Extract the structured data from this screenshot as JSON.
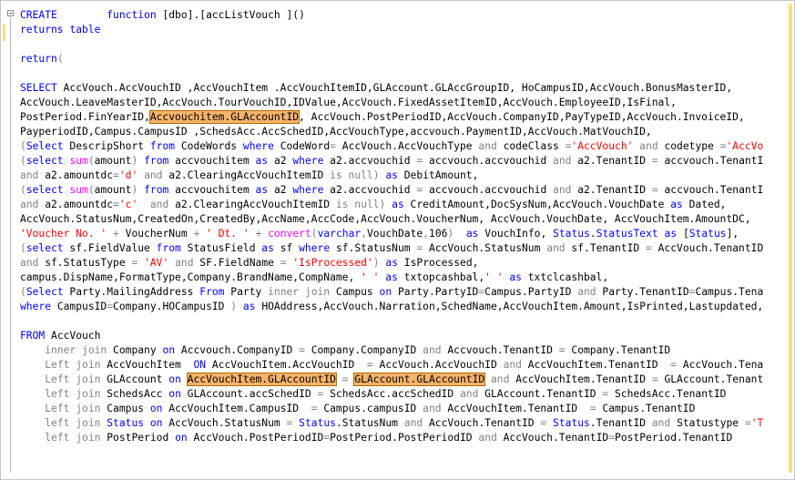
{
  "editor": {
    "lines": [
      [
        [
          "k",
          "CREATE"
        ],
        [
          "t",
          "        "
        ],
        [
          "k",
          "function"
        ],
        [
          "t",
          " [dbo].[accListVouch ]()"
        ]
      ],
      [
        [
          "k",
          "returns"
        ],
        [
          "t",
          " "
        ],
        [
          "k",
          "table"
        ]
      ],
      [],
      [
        [
          "k",
          "return"
        ],
        [
          "p",
          "("
        ]
      ],
      [],
      [
        [
          "k",
          "SELECT"
        ],
        [
          "t",
          " AccVouch.AccVouchID ,AccVouchItem .AccVouchItemID,GLAccount.GLAccGroupID, HoCampusID,AccVouch.BonusMasterID,"
        ]
      ],
      [
        [
          "t",
          "AccVouch.LeaveMasterID,AccVouch.TourVouchID,IDValue,AccVouch.FixedAssetItemID,AccVouch.EmployeeID,IsFinal,"
        ]
      ],
      [
        [
          "t",
          "PostPeriod.FinYearID,"
        ],
        [
          "h",
          "Accvouchitem.GLAccountID"
        ],
        [
          "t",
          ", AccVouch.PostPeriodID,AccVouch.CompanyID,PayTypeID,AccVouch.InvoiceID,"
        ]
      ],
      [
        [
          "t",
          "PayperiodID,Campus.CampusID ,SchedsAcc.AccSchedID,AccVouchType,accvouch.PaymentID,AccVouch.MatVouchID,"
        ]
      ],
      [
        [
          "p",
          "("
        ],
        [
          "k",
          "Select"
        ],
        [
          "t",
          " DescripShort "
        ],
        [
          "k",
          "from"
        ],
        [
          "t",
          " CodeWords "
        ],
        [
          "k",
          "where"
        ],
        [
          "t",
          " CodeWord"
        ],
        [
          "p",
          "="
        ],
        [
          "t",
          " AccVouch.AccVouchType "
        ],
        [
          "p",
          "and"
        ],
        [
          "t",
          " codeClass "
        ],
        [
          "p",
          "="
        ],
        [
          "s",
          "'AccVouch'"
        ],
        [
          "t",
          " "
        ],
        [
          "p",
          "and"
        ],
        [
          "t",
          " codetype "
        ],
        [
          "p",
          "="
        ],
        [
          "s",
          "'AccVo"
        ]
      ],
      [
        [
          "p",
          "("
        ],
        [
          "k",
          "select"
        ],
        [
          "t",
          " "
        ],
        [
          "f",
          "sum"
        ],
        [
          "p",
          "("
        ],
        [
          "t",
          "amount"
        ],
        [
          "p",
          ")"
        ],
        [
          "t",
          " "
        ],
        [
          "k",
          "from"
        ],
        [
          "t",
          " accvouchitem "
        ],
        [
          "k",
          "as"
        ],
        [
          "t",
          " a2 "
        ],
        [
          "k",
          "where"
        ],
        [
          "t",
          " a2.accvouchid "
        ],
        [
          "p",
          "="
        ],
        [
          "t",
          " accvouch.accvouchid "
        ],
        [
          "p",
          "and"
        ],
        [
          "t",
          " a2.TenantID "
        ],
        [
          "p",
          "="
        ],
        [
          "t",
          " accvouch.TenantI"
        ]
      ],
      [
        [
          "p",
          "and"
        ],
        [
          "t",
          " a2.amountdc"
        ],
        [
          "p",
          "="
        ],
        [
          "s",
          "'d'"
        ],
        [
          "t",
          " "
        ],
        [
          "p",
          "and"
        ],
        [
          "t",
          " a2.ClearingAccVouchItemID "
        ],
        [
          "p",
          "is null)"
        ],
        [
          "t",
          " "
        ],
        [
          "k",
          "as"
        ],
        [
          "t",
          " DebitAmount,"
        ]
      ],
      [
        [
          "p",
          "("
        ],
        [
          "k",
          "select"
        ],
        [
          "t",
          " "
        ],
        [
          "f",
          "sum"
        ],
        [
          "p",
          "("
        ],
        [
          "t",
          "amount"
        ],
        [
          "p",
          ")"
        ],
        [
          "t",
          " "
        ],
        [
          "k",
          "from"
        ],
        [
          "t",
          " accvouchitem "
        ],
        [
          "k",
          "as"
        ],
        [
          "t",
          " a2 "
        ],
        [
          "k",
          "where"
        ],
        [
          "t",
          " a2.accvouchid "
        ],
        [
          "p",
          "="
        ],
        [
          "t",
          " accvouch.accvouchid "
        ],
        [
          "p",
          "and"
        ],
        [
          "t",
          " a2.TenantID "
        ],
        [
          "p",
          "="
        ],
        [
          "t",
          " accvouch.TenantI"
        ]
      ],
      [
        [
          "p",
          "and"
        ],
        [
          "t",
          " a2.amountdc"
        ],
        [
          "p",
          "="
        ],
        [
          "s",
          "'c'"
        ],
        [
          "t",
          "  "
        ],
        [
          "p",
          "and"
        ],
        [
          "t",
          " a2.ClearingAccVouchItemID "
        ],
        [
          "p",
          "is null)"
        ],
        [
          "t",
          " "
        ],
        [
          "k",
          "as"
        ],
        [
          "t",
          " CreditAmount,DocSysNum,AccVouch.VouchDate "
        ],
        [
          "k",
          "as"
        ],
        [
          "t",
          " Dated,"
        ]
      ],
      [
        [
          "t",
          "AccVouch.StatusNum,CreatedOn,CreatedBy,AccName,AccCode,AccVouch.VoucherNum, AccVouch.VouchDate, AccVouchItem.AmountDC,"
        ]
      ],
      [
        [
          "s",
          "'Voucher No. '"
        ],
        [
          "t",
          " "
        ],
        [
          "p",
          "+"
        ],
        [
          "t",
          " VoucherNum "
        ],
        [
          "p",
          "+"
        ],
        [
          "t",
          " "
        ],
        [
          "s",
          "' Dt. '"
        ],
        [
          "t",
          " "
        ],
        [
          "p",
          "+"
        ],
        [
          "t",
          " "
        ],
        [
          "f",
          "convert"
        ],
        [
          "p",
          "("
        ],
        [
          "k",
          "varchar"
        ],
        [
          "p",
          ","
        ],
        [
          "t",
          "VouchDate"
        ],
        [
          "p",
          ","
        ],
        [
          "t",
          "106"
        ],
        [
          "p",
          ")"
        ],
        [
          "t",
          "  "
        ],
        [
          "k",
          "as"
        ],
        [
          "t",
          " VouchInfo, "
        ],
        [
          "k",
          "Status"
        ],
        [
          "t",
          "."
        ],
        [
          "k",
          "StatusText"
        ],
        [
          "t",
          " "
        ],
        [
          "k",
          "as"
        ],
        [
          "t",
          " ["
        ],
        [
          "k",
          "Status"
        ],
        [
          "t",
          "],"
        ]
      ],
      [
        [
          "p",
          "("
        ],
        [
          "k",
          "select"
        ],
        [
          "t",
          " sf.FieldValue "
        ],
        [
          "k",
          "from"
        ],
        [
          "t",
          " StatusField "
        ],
        [
          "k",
          "as"
        ],
        [
          "t",
          " sf "
        ],
        [
          "k",
          "where"
        ],
        [
          "t",
          " sf.StatusNum "
        ],
        [
          "p",
          "="
        ],
        [
          "t",
          " AccVouch.StatusNum "
        ],
        [
          "p",
          "and"
        ],
        [
          "t",
          " sf.TenantID "
        ],
        [
          "p",
          "="
        ],
        [
          "t",
          " AccVouch.TenantID"
        ]
      ],
      [
        [
          "p",
          "and"
        ],
        [
          "t",
          " sf.StatusType "
        ],
        [
          "p",
          "="
        ],
        [
          "t",
          " "
        ],
        [
          "s",
          "'AV'"
        ],
        [
          "t",
          " "
        ],
        [
          "p",
          "and"
        ],
        [
          "t",
          " SF.FieldName "
        ],
        [
          "p",
          "="
        ],
        [
          "t",
          " "
        ],
        [
          "s",
          "'IsProcessed'"
        ],
        [
          "p",
          ")"
        ],
        [
          "t",
          " "
        ],
        [
          "k",
          "as"
        ],
        [
          "t",
          " IsProcessed,"
        ]
      ],
      [
        [
          "t",
          "campus.DispName,FormatType,Company.BrandName,CompName, "
        ],
        [
          "s",
          "' '"
        ],
        [
          "t",
          " "
        ],
        [
          "k",
          "as"
        ],
        [
          "t",
          " txtopcashbal,"
        ],
        [
          "s",
          "' '"
        ],
        [
          "t",
          " "
        ],
        [
          "k",
          "as"
        ],
        [
          "t",
          " txtclcashbal,"
        ]
      ],
      [
        [
          "p",
          "("
        ],
        [
          "k",
          "Select"
        ],
        [
          "t",
          " Party.MailingAddress "
        ],
        [
          "k",
          "From"
        ],
        [
          "t",
          " Party "
        ],
        [
          "p",
          "inner join"
        ],
        [
          "t",
          " Campus "
        ],
        [
          "k",
          "on"
        ],
        [
          "t",
          " Party.PartyID"
        ],
        [
          "p",
          "="
        ],
        [
          "t",
          "Campus.PartyID "
        ],
        [
          "p",
          "and"
        ],
        [
          "t",
          " Party.TenantID"
        ],
        [
          "p",
          "="
        ],
        [
          "t",
          "Campus.Tena"
        ]
      ],
      [
        [
          "k",
          "where"
        ],
        [
          "t",
          " CampusID"
        ],
        [
          "p",
          "="
        ],
        [
          "t",
          "Company.HOCampusID "
        ],
        [
          "p",
          ")"
        ],
        [
          "t",
          " "
        ],
        [
          "k",
          "as"
        ],
        [
          "t",
          " HOAddress,AccVouch.Narration,SchedName,AccVouchItem.Amount,IsPrinted,Lastupdated,"
        ]
      ],
      [],
      [
        [
          "k",
          "FROM"
        ],
        [
          "t",
          " AccVouch"
        ]
      ],
      [
        [
          "t",
          "    "
        ],
        [
          "p",
          "inner join"
        ],
        [
          "t",
          " Company "
        ],
        [
          "k",
          "on"
        ],
        [
          "t",
          " Accvouch.CompanyID "
        ],
        [
          "p",
          "="
        ],
        [
          "t",
          " Company.CompanyID "
        ],
        [
          "p",
          "and"
        ],
        [
          "t",
          " Accvouch.TenantID "
        ],
        [
          "p",
          "="
        ],
        [
          "t",
          " Company.TenantID"
        ]
      ],
      [
        [
          "t",
          "    "
        ],
        [
          "p",
          "Left join"
        ],
        [
          "t",
          " AccVouchItem  "
        ],
        [
          "k",
          "ON"
        ],
        [
          "t",
          " AccVouchItem.AccVouchID  "
        ],
        [
          "p",
          "="
        ],
        [
          "t",
          " AccVouch.AccVouchID "
        ],
        [
          "p",
          "and"
        ],
        [
          "t",
          " AccVouchItem.TenantID  "
        ],
        [
          "p",
          "="
        ],
        [
          "t",
          " AccVouch.Tena"
        ]
      ],
      [
        [
          "t",
          "    "
        ],
        [
          "p",
          "Left join"
        ],
        [
          "t",
          " GLAccount "
        ],
        [
          "k",
          "on"
        ],
        [
          "t",
          " "
        ],
        [
          "h",
          "AccVouchItem.GLAccountID"
        ],
        [
          "t",
          " "
        ],
        [
          "p",
          "="
        ],
        [
          "t",
          " "
        ],
        [
          "h",
          "GLAccount.GLAccountID"
        ],
        [
          "t",
          " "
        ],
        [
          "p",
          "and"
        ],
        [
          "t",
          " AccVouchItem.TenantID "
        ],
        [
          "p",
          "="
        ],
        [
          "t",
          " GLAccount.Tenant"
        ]
      ],
      [
        [
          "t",
          "    "
        ],
        [
          "p",
          "left join"
        ],
        [
          "t",
          " SchedsAcc "
        ],
        [
          "k",
          "on"
        ],
        [
          "t",
          " GLAccount.accSchedID "
        ],
        [
          "p",
          "="
        ],
        [
          "t",
          " SchedsAcc.accSchedID "
        ],
        [
          "p",
          "and"
        ],
        [
          "t",
          " GLAccount.TenantID "
        ],
        [
          "p",
          "="
        ],
        [
          "t",
          " SchedsAcc.TenantID"
        ]
      ],
      [
        [
          "t",
          "    "
        ],
        [
          "p",
          "Left join"
        ],
        [
          "t",
          " Campus "
        ],
        [
          "k",
          "on"
        ],
        [
          "t",
          " AccVouchItem.CampusID  "
        ],
        [
          "p",
          "="
        ],
        [
          "t",
          " Campus.campusID "
        ],
        [
          "p",
          "and"
        ],
        [
          "t",
          " AccVouchItem.TenantID  "
        ],
        [
          "p",
          "="
        ],
        [
          "t",
          " Campus.TenantID"
        ]
      ],
      [
        [
          "t",
          "    "
        ],
        [
          "p",
          "left join"
        ],
        [
          "t",
          " "
        ],
        [
          "k",
          "Status"
        ],
        [
          "t",
          " "
        ],
        [
          "k",
          "on"
        ],
        [
          "t",
          " AccVouch.StatusNum "
        ],
        [
          "p",
          "="
        ],
        [
          "t",
          " "
        ],
        [
          "k",
          "Status"
        ],
        [
          "t",
          ".StatusNum "
        ],
        [
          "p",
          "and"
        ],
        [
          "t",
          " AccVouch.TenantID "
        ],
        [
          "p",
          "="
        ],
        [
          "t",
          " "
        ],
        [
          "k",
          "Status"
        ],
        [
          "t",
          ".TenantID "
        ],
        [
          "p",
          "and"
        ],
        [
          "t",
          " Statustype "
        ],
        [
          "p",
          "="
        ],
        [
          "s",
          "'T"
        ]
      ],
      [
        [
          "t",
          "    "
        ],
        [
          "p",
          "left join"
        ],
        [
          "t",
          " PostPeriod "
        ],
        [
          "k",
          "on"
        ],
        [
          "t",
          " AccVouch.PostPeriodID"
        ],
        [
          "p",
          "="
        ],
        [
          "t",
          "PostPeriod.PostPeriodID "
        ],
        [
          "p",
          "and"
        ],
        [
          "t",
          " AccVouch.TenantID"
        ],
        [
          "p",
          "="
        ],
        [
          "t",
          "PostPeriod.TenantID"
        ]
      ],
      [],
      [],
      [
        [
          "p",
          ")"
        ]
      ]
    ]
  }
}
